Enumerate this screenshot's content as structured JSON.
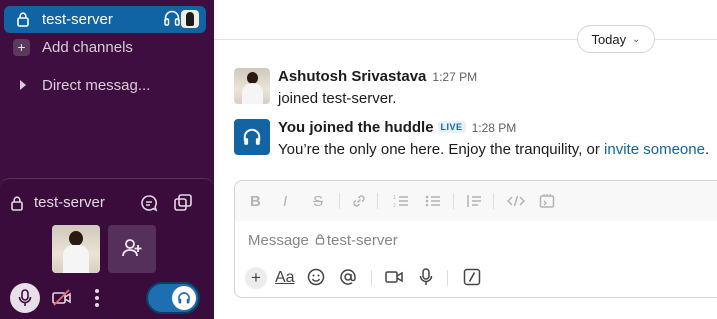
{
  "sidebar": {
    "active_channel": "test-server",
    "add_channels_label": "Add channels",
    "add_channels_icon": "+",
    "direct_messages_label": "Direct messag..."
  },
  "huddle_panel": {
    "channel_name": "test-server"
  },
  "main": {
    "date_divider": "Today",
    "messages": [
      {
        "author": "Ashutosh Srivastava",
        "time": "1:27 PM",
        "text": "joined test-server."
      },
      {
        "author": "You joined the huddle",
        "badge": "LIVE",
        "time": "1:28 PM",
        "text": "You’re the only one here. Enjoy the tranquility, or",
        "link": "invite someone",
        "end": "."
      }
    ],
    "composer": {
      "placeholder_prefix": "Message",
      "placeholder_channel": "test-server",
      "plus_label": "+",
      "text_format_label": "Aa"
    }
  },
  "colors": {
    "sidebar_bg": "#3f0e40",
    "active_channel_bg": "#1164a3",
    "link": "#1264a3"
  }
}
